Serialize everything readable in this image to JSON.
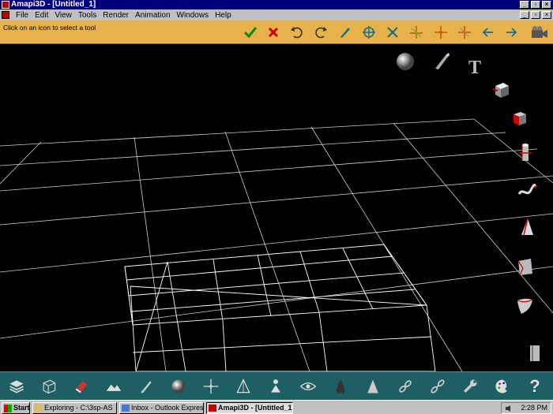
{
  "window": {
    "title": "Amapi3D - [Untitled_1]"
  },
  "menubar": {
    "items": [
      "File",
      "Edit",
      "View",
      "Tools",
      "Render",
      "Animation",
      "Windows",
      "Help"
    ]
  },
  "toolbar": {
    "status_text": "Click on an icon to select a tool",
    "buttons": [
      "check-icon",
      "cross-icon",
      "undo-icon",
      "redo-icon",
      "pen-icon",
      "target-icon",
      "scale-icon",
      "axis-icon",
      "axis-cross-icon",
      "axis-alt-icon",
      "arrow-left-icon",
      "arrow-right-icon",
      "camera-icon"
    ]
  },
  "viewport": {
    "side_icons": [
      "sphere-icon",
      "brush-icon",
      "text-icon",
      "cube-icon",
      "box-icon",
      "cylinder-icon",
      "curve-icon",
      "cone-icon",
      "surface-icon",
      "patch-icon",
      "book-icon"
    ],
    "text_tool_label": "T"
  },
  "bottombar": {
    "tools": [
      "layers-icon",
      "box-outline-icon",
      "eraser-icon",
      "terrain-icon",
      "pen-tool-icon",
      "sphere-tool-icon",
      "snap-icon",
      "vertex-icon",
      "person-icon",
      "eye-icon",
      "shape-icon",
      "cone-tool-icon",
      "chain-icon",
      "chain-alt-icon",
      "wrench-icon",
      "palette-icon",
      "help-icon"
    ],
    "help_label": "?"
  },
  "taskbar": {
    "start_label": "Start",
    "tasks": [
      {
        "label": "Exploring - C:\\3sp-AS",
        "active": false
      },
      {
        "label": "Inbox - Outlook Express",
        "active": false
      },
      {
        "label": "Amapi3D - [Untitled_1]",
        "active": true
      }
    ],
    "clock": "2:28 PM"
  },
  "colors": {
    "toolbar": "#e8b24a",
    "bottombar": "#1e5f64",
    "titlebar": "#00007b",
    "grid": "#d8d8d8"
  }
}
